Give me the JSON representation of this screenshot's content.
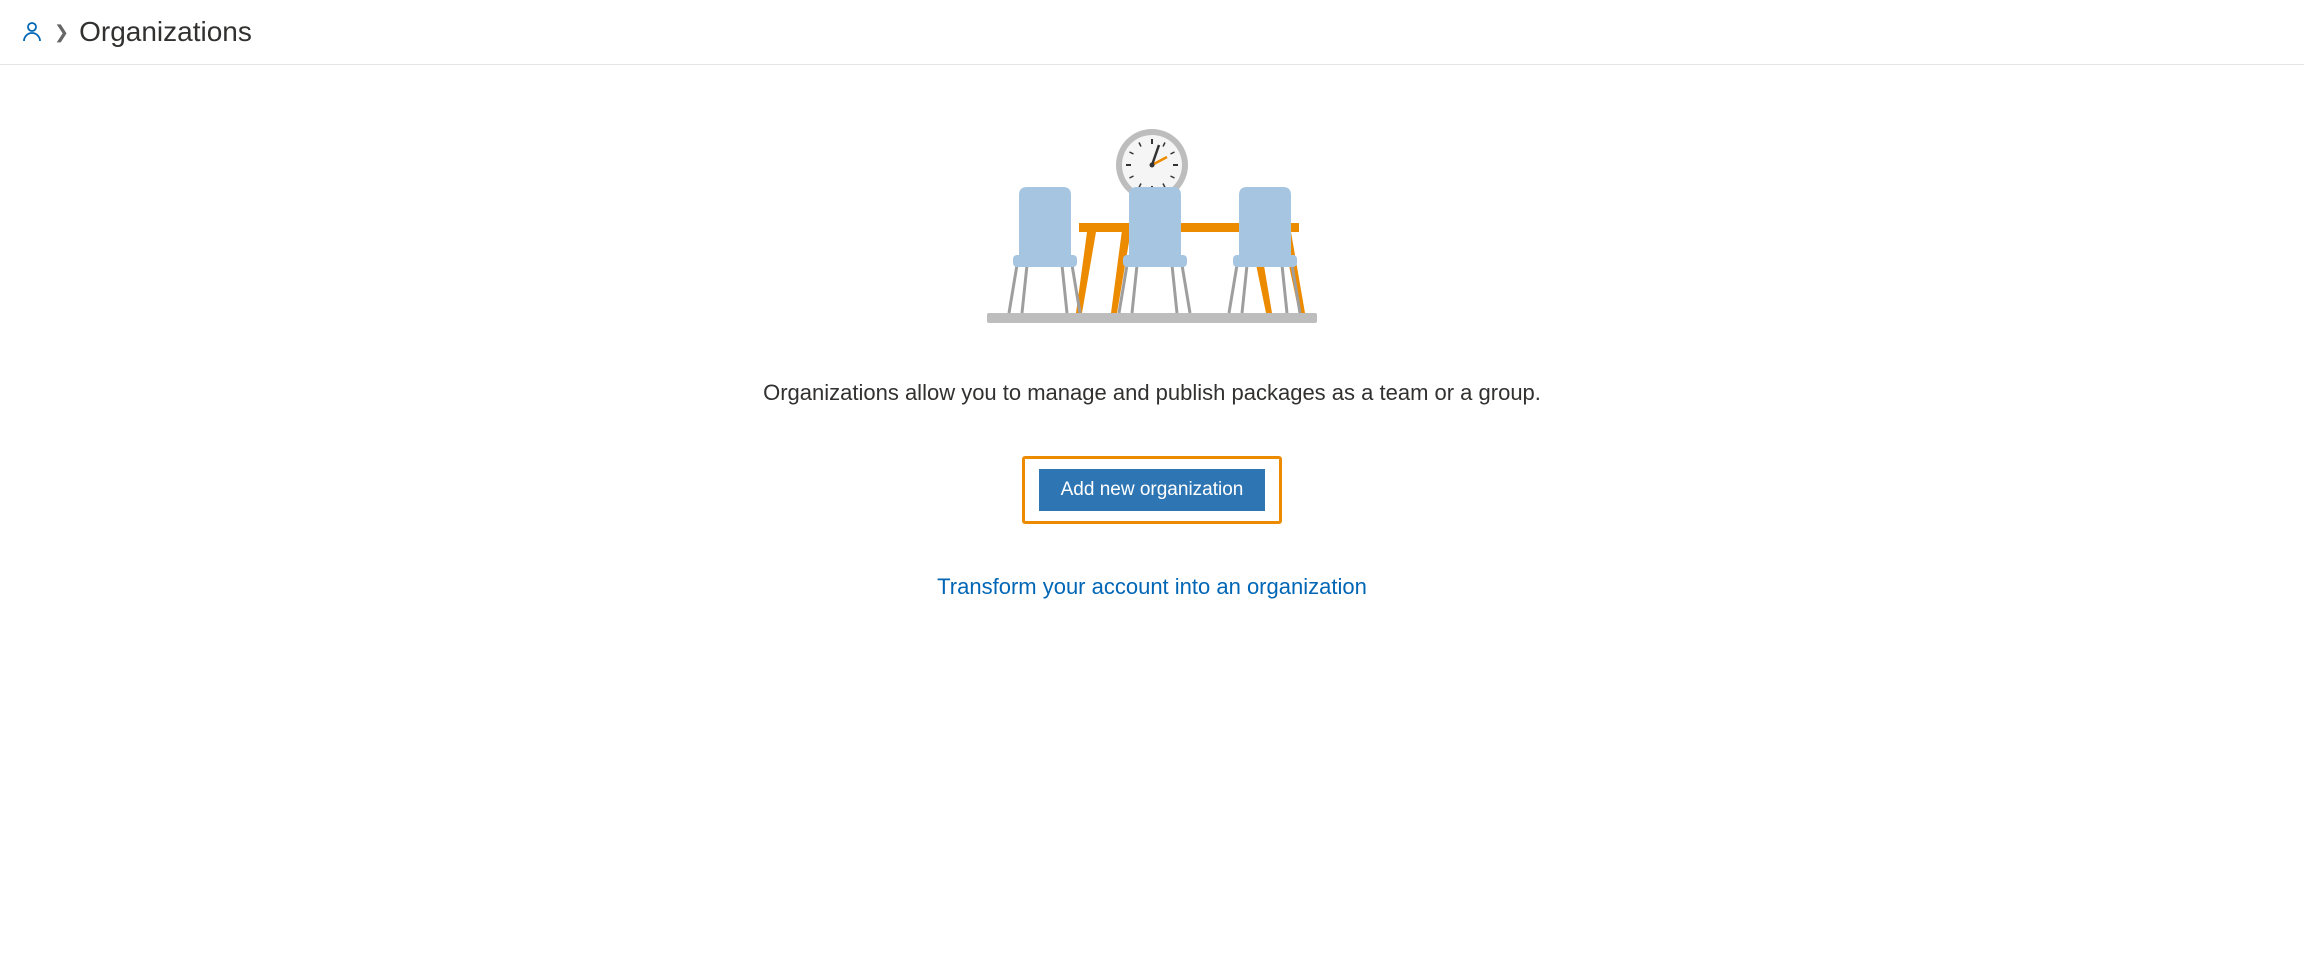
{
  "breadcrumb": {
    "title": "Organizations"
  },
  "main": {
    "description": "Organizations allow you to manage and publish packages as a team or a group.",
    "add_button_label": "Add new organization",
    "transform_link_label": "Transform your account into an organization"
  }
}
